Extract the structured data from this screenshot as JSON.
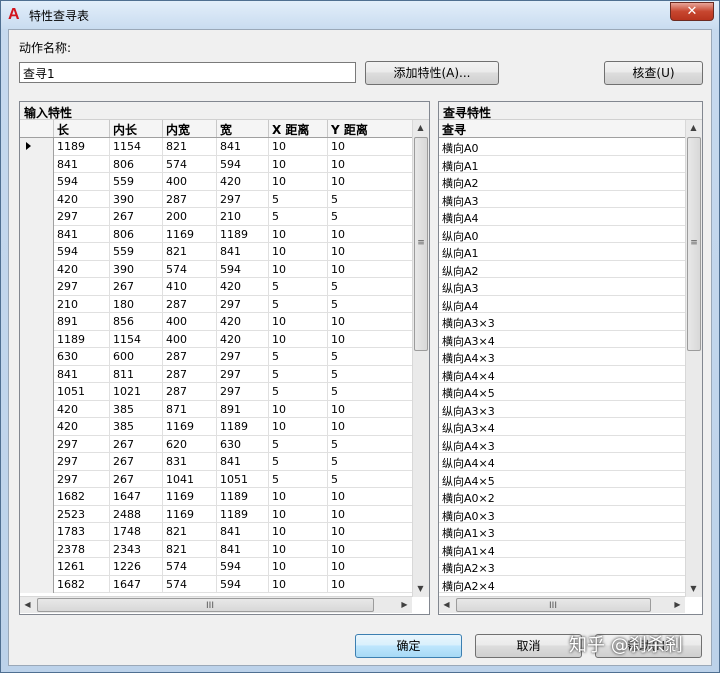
{
  "window": {
    "title": "特性查寻表",
    "app_icon": "A",
    "close_glyph": "✕"
  },
  "action": {
    "label": "动作名称:",
    "value": "查寻1"
  },
  "buttons": {
    "add_props": "添加特性(A)...",
    "audit": "核查(U)",
    "ok": "确定",
    "cancel": "取消",
    "help": "帮助(H)"
  },
  "input_panel": {
    "title": "输入特性",
    "columns": [
      "长",
      "内长",
      "内宽",
      "宽",
      "X 距离",
      "Y 距离"
    ],
    "rows": [
      [
        "1189",
        "1154",
        "821",
        "841",
        "10",
        "10"
      ],
      [
        "841",
        "806",
        "574",
        "594",
        "10",
        "10"
      ],
      [
        "594",
        "559",
        "400",
        "420",
        "10",
        "10"
      ],
      [
        "420",
        "390",
        "287",
        "297",
        "5",
        "5"
      ],
      [
        "297",
        "267",
        "200",
        "210",
        "5",
        "5"
      ],
      [
        "841",
        "806",
        "1169",
        "1189",
        "10",
        "10"
      ],
      [
        "594",
        "559",
        "821",
        "841",
        "10",
        "10"
      ],
      [
        "420",
        "390",
        "574",
        "594",
        "10",
        "10"
      ],
      [
        "297",
        "267",
        "410",
        "420",
        "5",
        "5"
      ],
      [
        "210",
        "180",
        "287",
        "297",
        "5",
        "5"
      ],
      [
        "891",
        "856",
        "400",
        "420",
        "10",
        "10"
      ],
      [
        "1189",
        "1154",
        "400",
        "420",
        "10",
        "10"
      ],
      [
        "630",
        "600",
        "287",
        "297",
        "5",
        "5"
      ],
      [
        "841",
        "811",
        "287",
        "297",
        "5",
        "5"
      ],
      [
        "1051",
        "1021",
        "287",
        "297",
        "5",
        "5"
      ],
      [
        "420",
        "385",
        "871",
        "891",
        "10",
        "10"
      ],
      [
        "420",
        "385",
        "1169",
        "1189",
        "10",
        "10"
      ],
      [
        "297",
        "267",
        "620",
        "630",
        "5",
        "5"
      ],
      [
        "297",
        "267",
        "831",
        "841",
        "5",
        "5"
      ],
      [
        "297",
        "267",
        "1041",
        "1051",
        "5",
        "5"
      ],
      [
        "1682",
        "1647",
        "1169",
        "1189",
        "10",
        "10"
      ],
      [
        "2523",
        "2488",
        "1169",
        "1189",
        "10",
        "10"
      ],
      [
        "1783",
        "1748",
        "821",
        "841",
        "10",
        "10"
      ],
      [
        "2378",
        "2343",
        "821",
        "841",
        "10",
        "10"
      ],
      [
        "1261",
        "1226",
        "574",
        "594",
        "10",
        "10"
      ],
      [
        "1682",
        "1647",
        "574",
        "594",
        "10",
        "10"
      ]
    ]
  },
  "lookup_panel": {
    "title": "查寻特性",
    "column": "查寻",
    "rows": [
      "横向A0",
      "横向A1",
      "横向A2",
      "横向A3",
      "横向A4",
      "纵向A0",
      "纵向A1",
      "纵向A2",
      "纵向A3",
      "纵向A4",
      "横向A3×3",
      "横向A3×4",
      "横向A4×3",
      "横向A4×4",
      "横向A4×5",
      "纵向A3×3",
      "纵向A3×4",
      "纵向A4×3",
      "纵向A4×4",
      "纵向A4×5",
      "横向A0×2",
      "横向A0×3",
      "横向A1×3",
      "横向A1×4",
      "横向A2×3",
      "横向A2×4"
    ]
  },
  "scroll_glyphs": {
    "up": "▲",
    "down": "▼",
    "left": "◀",
    "right": "▶",
    "grip_v": "≡",
    "grip_h": "III"
  },
  "watermark": "知乎 @刹杀剎"
}
